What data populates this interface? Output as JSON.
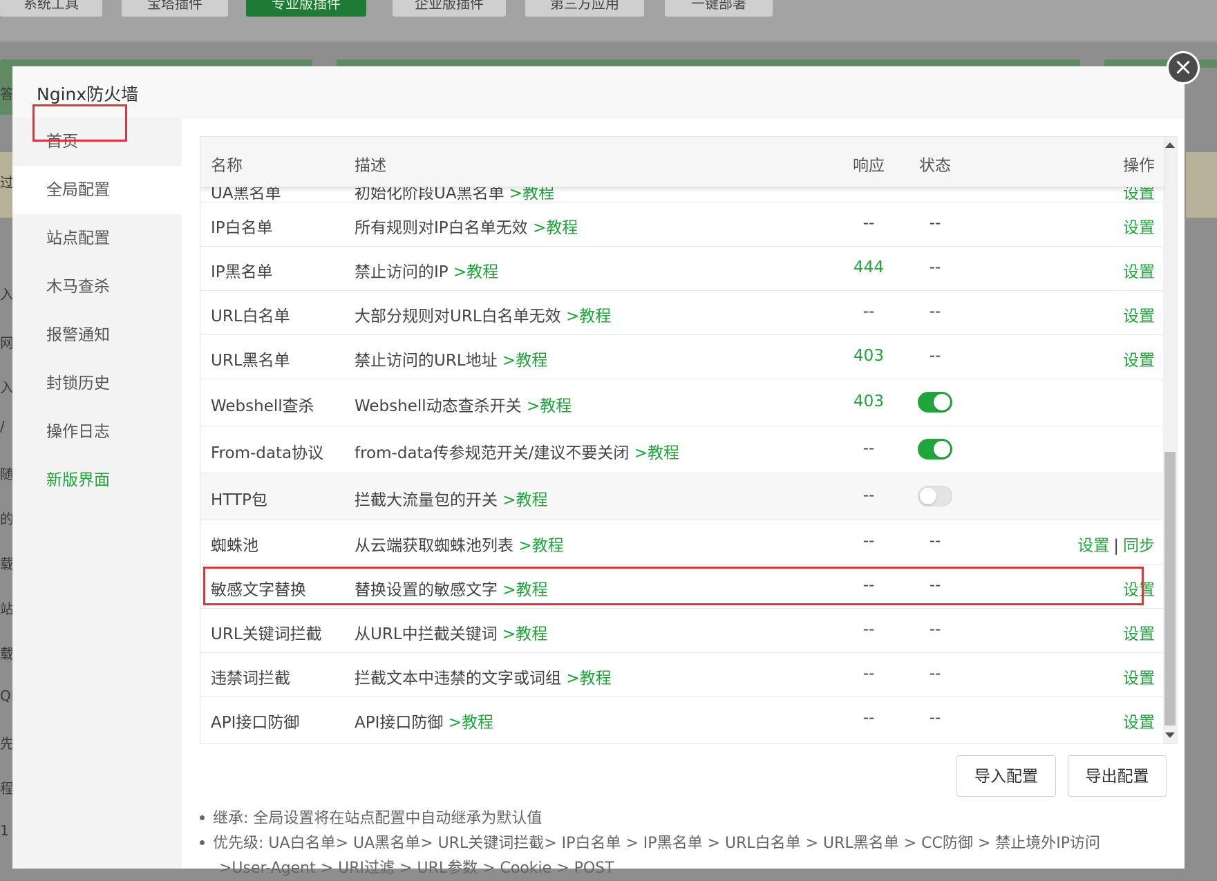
{
  "background": {
    "tabs": [
      "系统工具",
      "宝塔插件",
      "专业版插件",
      "企业版插件",
      "第三方应用",
      "一键部署"
    ],
    "active_tab": 2,
    "left_glyphs": [
      "答",
      "过",
      "入",
      "网",
      "入",
      "/",
      "随",
      "的",
      "载",
      "站",
      "载",
      "QL",
      "先",
      "程",
      "1"
    ]
  },
  "modal": {
    "title": "Nginx防火墙",
    "close_label": "×"
  },
  "sidebar": {
    "items": [
      {
        "label": "首页"
      },
      {
        "label": "全局配置"
      },
      {
        "label": "站点配置"
      },
      {
        "label": "木马查杀"
      },
      {
        "label": "报警通知"
      },
      {
        "label": "封锁历史"
      },
      {
        "label": "操作日志"
      },
      {
        "label": "新版界面"
      }
    ],
    "active_index": 1
  },
  "table": {
    "headers": {
      "name": "名称",
      "desc": "描述",
      "resp": "响应",
      "status": "状态",
      "op": "操作"
    },
    "partial_row": {
      "name": "UA黑名单",
      "desc": "初始化阶段UA黑名单",
      "link": ">教程",
      "op": "设置"
    },
    "rows": [
      {
        "name": "IP白名单",
        "desc": "所有规则对IP白名单无效 ",
        "link": ">教程",
        "resp": "--",
        "status": "--",
        "op": [
          "设置"
        ]
      },
      {
        "name": "IP黑名单",
        "desc": "禁止访问的IP ",
        "link": ">教程",
        "resp": "444",
        "status": "--",
        "op": [
          "设置"
        ]
      },
      {
        "name": "URL白名单",
        "desc": "大部分规则对URL白名单无效 ",
        "link": ">教程",
        "resp": "--",
        "status": "--",
        "op": [
          "设置"
        ]
      },
      {
        "name": "URL黑名单",
        "desc": "禁止访问的URL地址 ",
        "link": ">教程",
        "resp": "403",
        "status": "--",
        "op": [
          "设置"
        ]
      },
      {
        "name": "Webshell查杀",
        "desc": "Webshell动态查杀开关 ",
        "link": ">教程",
        "resp": "403",
        "status": "on",
        "op": []
      },
      {
        "name": "From-data协议",
        "desc": "from-data传参规范开关/建议不要关闭 ",
        "link": ">教程",
        "resp": "--",
        "status": "on",
        "op": []
      },
      {
        "name": "HTTP包",
        "desc": "拦截大流量包的开关 ",
        "link": ">教程",
        "resp": "--",
        "status": "off",
        "op": []
      },
      {
        "name": "蜘蛛池",
        "desc": "从云端获取蜘蛛池列表 ",
        "link": ">教程",
        "resp": "--",
        "status": "--",
        "op": [
          "设置",
          "同步"
        ]
      },
      {
        "name": "敏感文字替换",
        "desc": "替换设置的敏感文字 ",
        "link": ">教程",
        "resp": "--",
        "status": "--",
        "op": [
          "设置"
        ]
      },
      {
        "name": "URL关键词拦截",
        "desc": "从URL中拦截关键词 ",
        "link": ">教程",
        "resp": "--",
        "status": "--",
        "op": [
          "设置"
        ]
      },
      {
        "name": "违禁词拦截",
        "desc": "拦截文本中违禁的文字或词组 ",
        "link": ">教程",
        "resp": "--",
        "status": "--",
        "op": [
          "设置"
        ]
      },
      {
        "name": "API接口防御",
        "desc": "API接口防御 ",
        "link": ">教程",
        "resp": "--",
        "status": "--",
        "op": [
          "设置"
        ]
      }
    ],
    "highlighted_row": 8
  },
  "buttons": {
    "import_label": "导入配置",
    "export_label": "导出配置"
  },
  "notes": {
    "line1": "继承: 全局设置将在站点配置中自动继承为默认值",
    "line2": "优先级: UA白名单> UA黑名单> URL关键词拦截> IP白名单 > IP黑名单 > URL白名单 > URL黑名单 > CC防御 > 禁止境外IP访问",
    "line3": ">User-Agent > URI过滤 > URL参数 > Cookie > POST"
  },
  "colors": {
    "accent_green": "#20a53a",
    "highlight_red": "#d9363e"
  }
}
